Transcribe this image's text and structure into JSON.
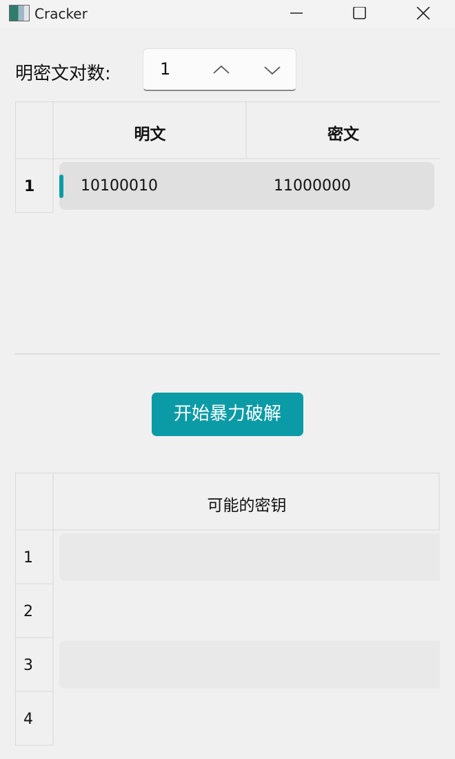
{
  "window": {
    "title": "Cracker"
  },
  "pairs": {
    "label": "明密文对数:",
    "value": "1"
  },
  "input_table": {
    "columns": [
      "明文",
      "密文"
    ],
    "rows": [
      {
        "num": "1",
        "plaintext": "10100010",
        "ciphertext": "11000000"
      }
    ]
  },
  "crack_button": {
    "label": "开始暴力破解"
  },
  "result_table": {
    "column": "可能的密钥",
    "rows": [
      "1",
      "2",
      "3",
      "4"
    ]
  },
  "colors": {
    "accent": "#0b9ba6"
  }
}
